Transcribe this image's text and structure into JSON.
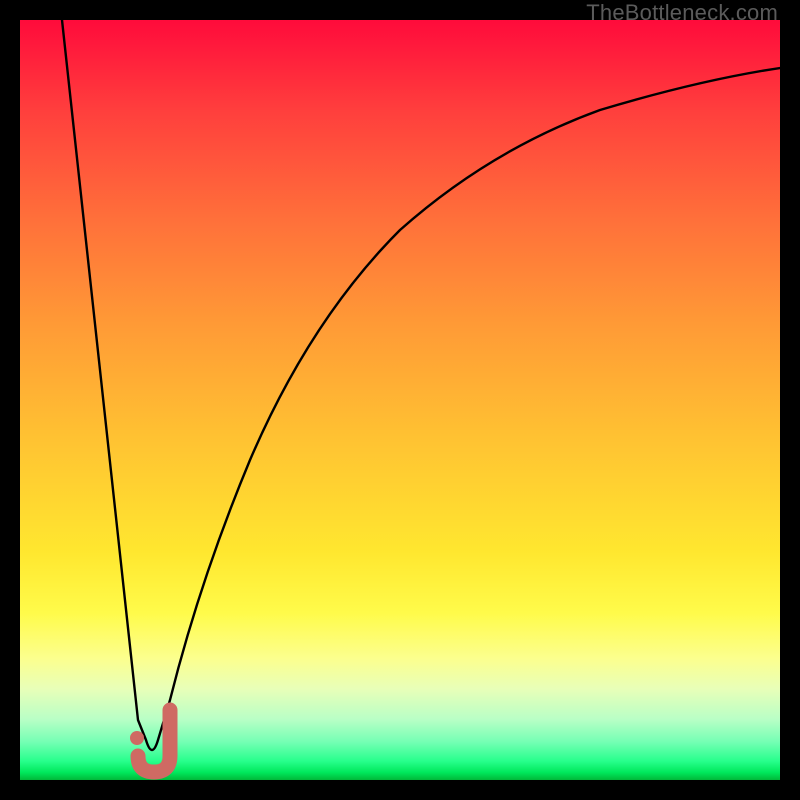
{
  "watermark": "TheBottleneck.com",
  "colors": {
    "frame": "#000000",
    "curve": "#000000",
    "marker": "#cf6a63",
    "gradient_top": "#ff0b3b",
    "gradient_bottom": "#00b839"
  },
  "chart_data": {
    "type": "line",
    "title": "",
    "xlabel": "",
    "ylabel": "",
    "xlim": [
      0,
      100
    ],
    "ylim": [
      0,
      100
    ],
    "grid": false,
    "legend": false,
    "series": [
      {
        "name": "bottleneck-curve",
        "x": [
          5,
          8,
          10,
          12,
          14,
          15,
          16,
          17,
          18,
          20,
          22,
          25,
          28,
          32,
          36,
          40,
          45,
          50,
          55,
          60,
          65,
          70,
          75,
          80,
          85,
          90,
          95,
          100
        ],
        "y": [
          100,
          80,
          66,
          52,
          38,
          24,
          10,
          2,
          2,
          10,
          22,
          38,
          50,
          60,
          68,
          74,
          79,
          83,
          86,
          88.5,
          90.5,
          92,
          93.2,
          94.2,
          95,
          95.6,
          96.1,
          96.5
        ]
      }
    ],
    "marker": {
      "name": "optimal-point-marker",
      "shape": "J",
      "x": 17,
      "y": 1,
      "width": 5,
      "height": 7
    }
  }
}
